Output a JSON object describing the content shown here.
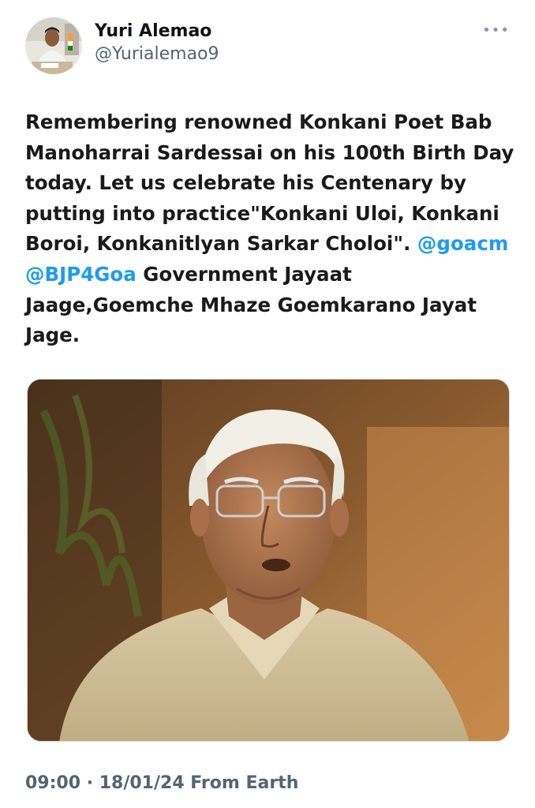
{
  "author": {
    "display_name": "Yuri Alemao",
    "handle": "@Yurialemao9",
    "avatar_icon": "profile-photo"
  },
  "more_icon": "•••",
  "tweet": {
    "text_lines": [
      "Remembering renowned Konkani Poet Bab",
      "Manoharrai Sardessai on his 100th Birth Day",
      "today. Let us celebrate his Centenary by",
      "putting into practice\"Konkani Uloi, Konkani"
    ],
    "line5_text": "Boroi, Konkanitlyan Sarkar Choloi\". ",
    "mention_1": "@goacm",
    "mention_2": "@BJP4Goa",
    "line6_text": " Government Jayaat",
    "line7_text": "Jaage,Goemche Mhaze Goemkarano Jayat",
    "line8_text": "Jage."
  },
  "media": {
    "image_icon": "portrait-photo"
  },
  "footer": {
    "time": "09:00",
    "separator": " · ",
    "date": "18/01/24",
    "source": " From Earth"
  },
  "colors": {
    "link": "#1d9bf0",
    "secondary": "#536471",
    "primary": "#0f1419"
  }
}
